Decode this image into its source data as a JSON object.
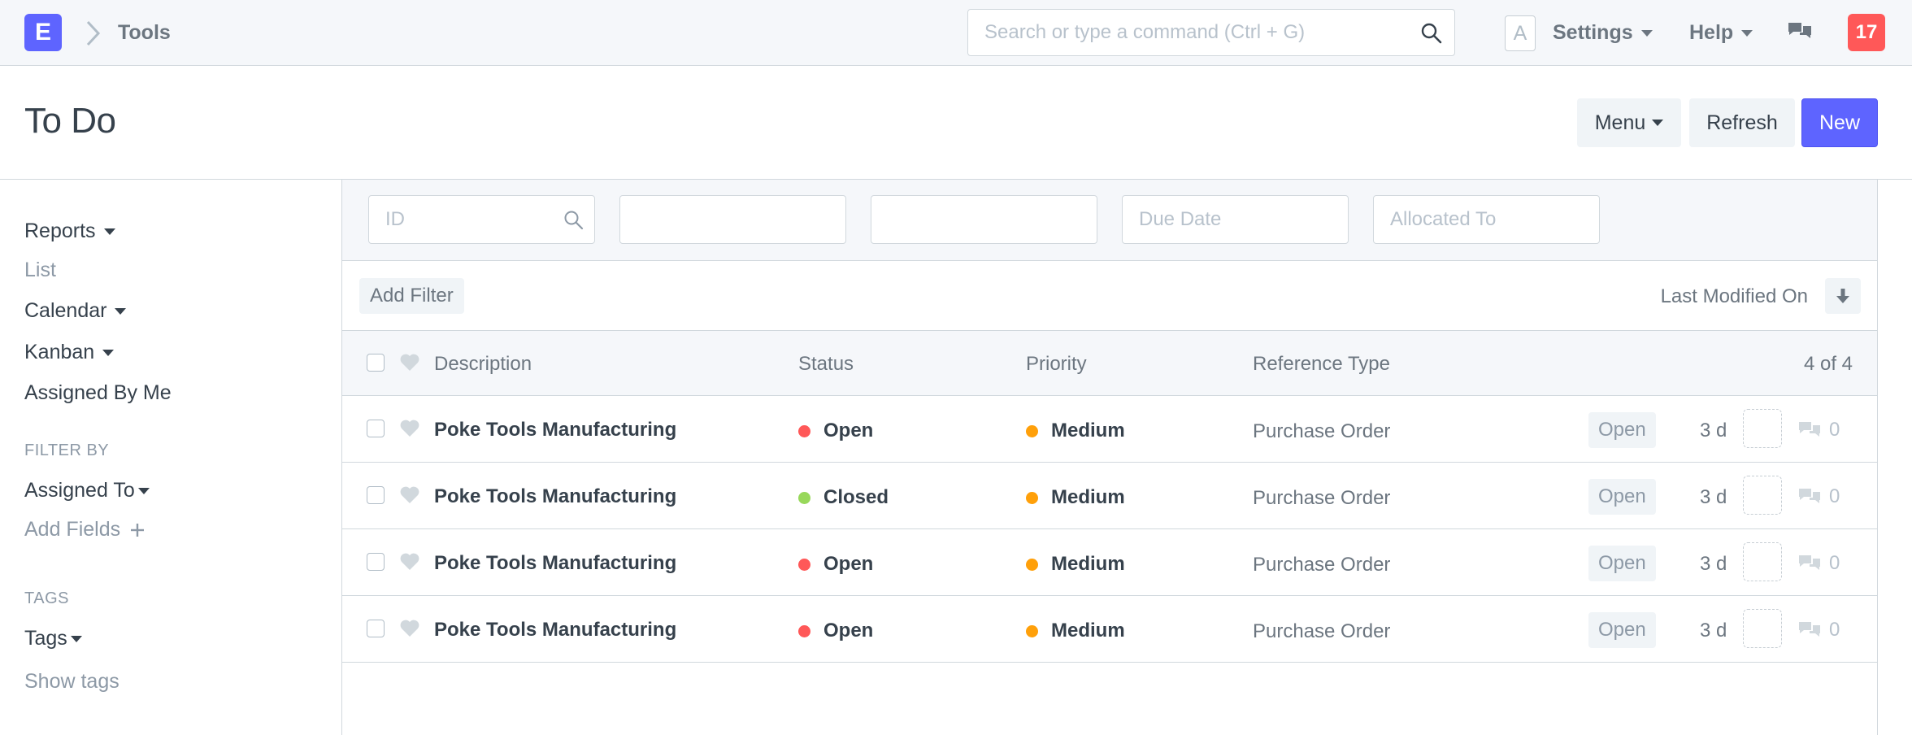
{
  "navbar": {
    "brand_letter": "E",
    "breadcrumb": "Tools",
    "search_placeholder": "Search or type a command (Ctrl + G)",
    "avatar_letter": "A",
    "settings_label": "Settings",
    "help_label": "Help",
    "notification_count": "17"
  },
  "page": {
    "title": "To Do",
    "menu_label": "Menu",
    "refresh_label": "Refresh",
    "new_label": "New"
  },
  "sidebar": {
    "items": [
      {
        "label": "Reports"
      },
      {
        "label": "List"
      },
      {
        "label": "Calendar"
      },
      {
        "label": "Kanban"
      },
      {
        "label": "Assigned By Me"
      }
    ],
    "filter_heading": "FILTER BY",
    "assigned_to": "Assigned To",
    "add_fields": "Add Fields",
    "tags_heading": "TAGS",
    "tags": "Tags",
    "show_tags": "Show tags"
  },
  "filters": {
    "id_placeholder": "ID",
    "field2_placeholder": "",
    "field3_placeholder": "",
    "due_date_placeholder": "Due Date",
    "allocated_to_placeholder": "Allocated To"
  },
  "sort": {
    "add_filter": "Add Filter",
    "sort_by": "Last Modified On"
  },
  "list": {
    "columns": {
      "description": "Description",
      "status": "Status",
      "priority": "Priority",
      "reference_type": "Reference Type",
      "count": "4 of 4"
    },
    "rows": [
      {
        "description": "Poke Tools Manufacturing",
        "status": "Open",
        "priority": "Medium",
        "reference_type": "Purchase Order",
        "tag": "Open",
        "modified": "3 d",
        "comments": "0"
      },
      {
        "description": "Poke Tools Manufacturing",
        "status": "Closed",
        "priority": "Medium",
        "reference_type": "Purchase Order",
        "tag": "Open",
        "modified": "3 d",
        "comments": "0"
      },
      {
        "description": "Poke Tools Manufacturing",
        "status": "Open",
        "priority": "Medium",
        "reference_type": "Purchase Order",
        "tag": "Open",
        "modified": "3 d",
        "comments": "0"
      },
      {
        "description": "Poke Tools Manufacturing",
        "status": "Open",
        "priority": "Medium",
        "reference_type": "Purchase Order",
        "tag": "Open",
        "modified": "3 d",
        "comments": "0"
      }
    ]
  },
  "colors": {
    "primary": "#5e64ff",
    "status_open": "#ff5858",
    "status_closed": "#98d85b",
    "priority_medium": "#ffa00a",
    "notification": "#ff5858"
  }
}
